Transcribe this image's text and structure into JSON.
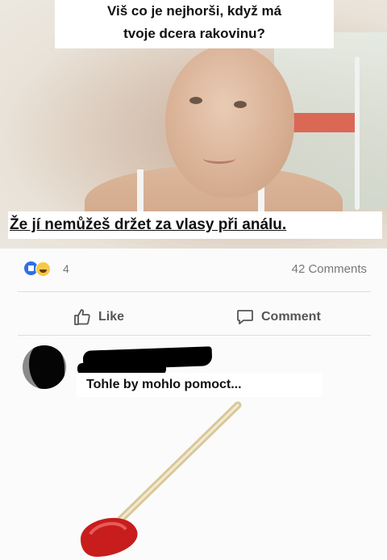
{
  "post": {
    "top_caption_line1": "Viš co je nejhorši, když má",
    "top_caption_line2": "tvoje dcera rakovinu?",
    "bottom_caption": "Že jí nemůžeš držet za vlasy při análu."
  },
  "stats": {
    "reaction_count": "4",
    "comments_count": "42 Comments"
  },
  "actions": {
    "like_label": "Like",
    "comment_label": "Comment"
  },
  "comment": {
    "text": "Tohle by mohlo pomoct..."
  },
  "colors": {
    "like_blue": "#2f6ee6",
    "haha_yellow": "#f6c945",
    "plunger_red": "#c71d1d"
  }
}
